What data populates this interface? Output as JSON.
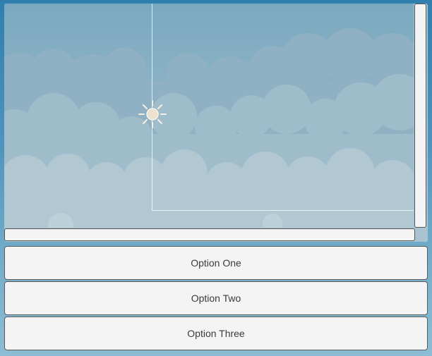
{
  "scroll_view": {
    "background_color": "#8fb3c6",
    "vertical_scrollbar_color": "#f4f4f4",
    "horizontal_scrollbar_color": "#f4f4f4",
    "pivot_icon": "sun-icon"
  },
  "options": [
    {
      "label": "Option One"
    },
    {
      "label": "Option Two"
    },
    {
      "label": "Option Three"
    }
  ]
}
